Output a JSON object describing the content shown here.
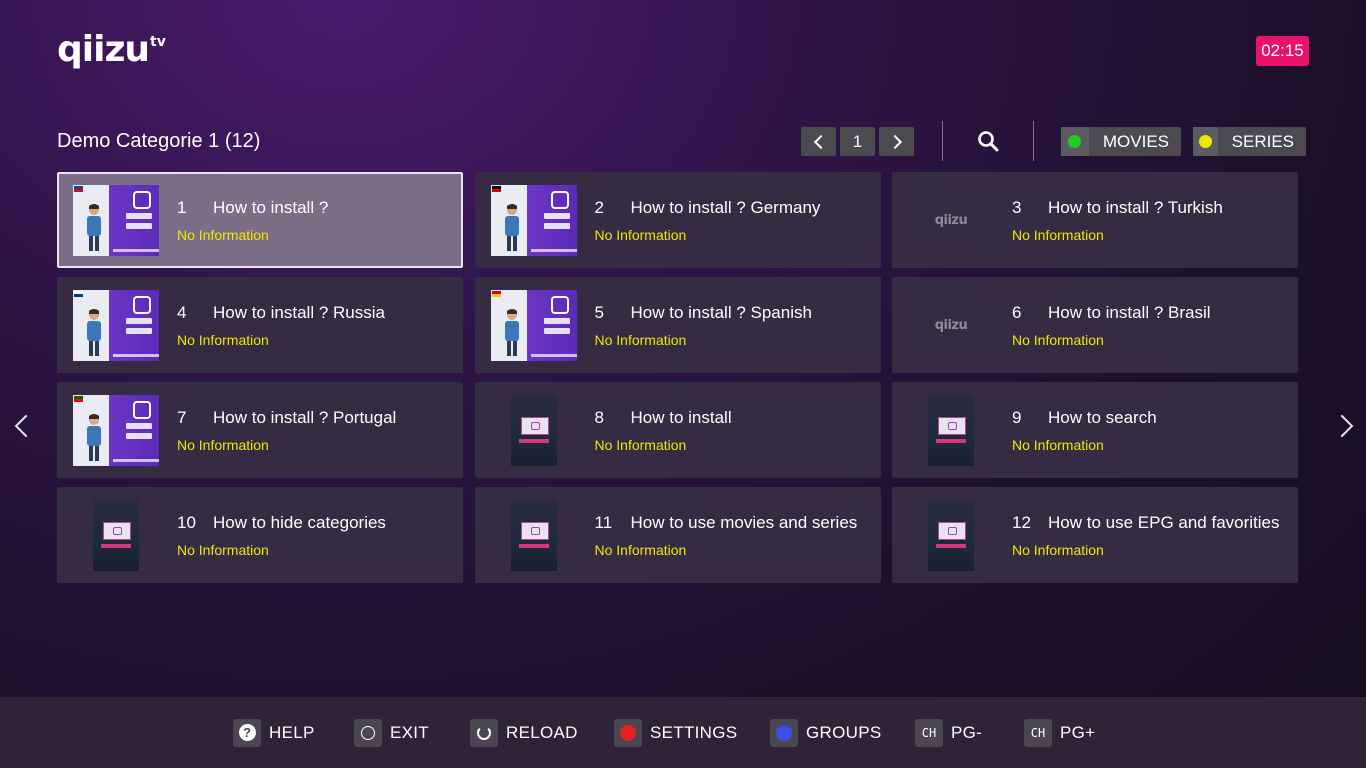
{
  "app": {
    "logo_main": "qiizu",
    "logo_suffix": "tv",
    "clock": "02:15"
  },
  "category": {
    "title": "Demo Categorie 1 (12)"
  },
  "pager": {
    "page": "1"
  },
  "filters": {
    "movies": {
      "label": "MOVIES",
      "dot_color": "#1fcf1f"
    },
    "series": {
      "label": "SERIES",
      "dot_color": "#f2e600"
    }
  },
  "items": [
    {
      "num": "1",
      "title": "How to install ?",
      "info": "No Information",
      "thumb": "video",
      "flag": "uk",
      "selected": true
    },
    {
      "num": "2",
      "title": "How to install ? Germany",
      "info": "No Information",
      "thumb": "video",
      "flag": "de"
    },
    {
      "num": "3",
      "title": "How to install ? Turkish",
      "info": "No Information",
      "thumb": "logo"
    },
    {
      "num": "4",
      "title": "How to install ? Russia",
      "info": "No Information",
      "thumb": "video",
      "flag": "ru"
    },
    {
      "num": "5",
      "title": "How to install ? Spanish",
      "info": "No Information",
      "thumb": "video",
      "flag": "es"
    },
    {
      "num": "6",
      "title": "How to install ? Brasil",
      "info": "No Information",
      "thumb": "logo"
    },
    {
      "num": "7",
      "title": "How to install ? Portugal",
      "info": "No Information",
      "thumb": "video",
      "flag": "pt"
    },
    {
      "num": "8",
      "title": "How to install",
      "info": "No Information",
      "thumb": "screen"
    },
    {
      "num": "9",
      "title": "How to search",
      "info": "No Information",
      "thumb": "screen"
    },
    {
      "num": "10",
      "title": "How to hide categories",
      "info": "No Information",
      "thumb": "screen"
    },
    {
      "num": "11",
      "title": "How to use movies and series",
      "info": "No Information",
      "thumb": "screen"
    },
    {
      "num": "12",
      "title": "How to use EPG and favorities",
      "info": "No Information",
      "thumb": "screen"
    }
  ],
  "footer": {
    "help": "HELP",
    "exit": "EXIT",
    "reload": "RELOAD",
    "settings": "SETTINGS",
    "settings_color": "#e52222",
    "groups": "GROUPS",
    "groups_color": "#3a4ee8",
    "ch_key": "CH",
    "pg_minus": "PG-",
    "pg_plus": "PG+"
  },
  "icons": {
    "search": "search-icon",
    "prev": "chevron-left-icon",
    "next": "chevron-right-icon"
  }
}
